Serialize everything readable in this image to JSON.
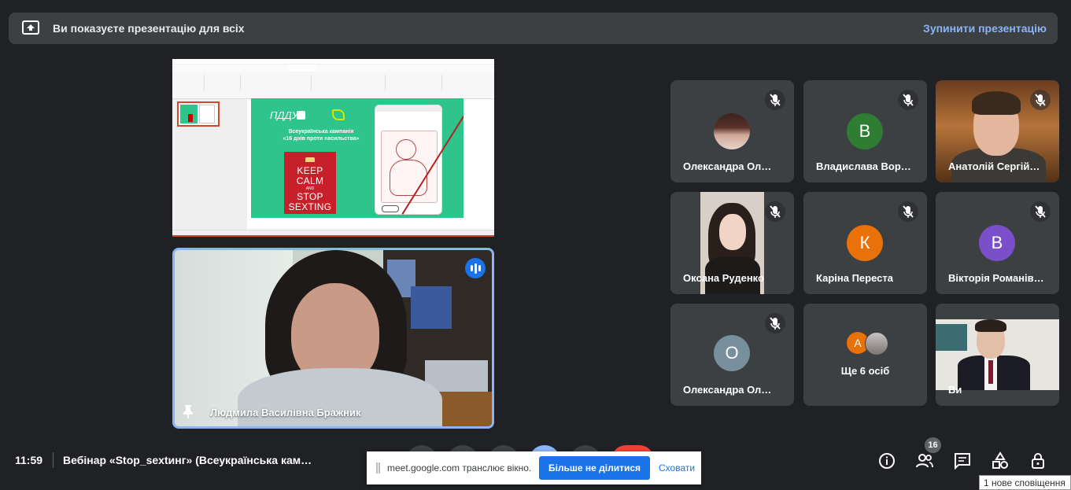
{
  "banner": {
    "title": "Ви показуєте презентацію для всіх",
    "stop": "Зупинити презентацію"
  },
  "slide": {
    "logo": "ПДДУ",
    "campaign_line1": "Всеукраїнська кампанія",
    "campaign_line2": "«16 днів проти насильства»",
    "keep": "KEEP",
    "calm": "CALM",
    "and": "AND",
    "stop": "STOP",
    "sexting": "SEXTING"
  },
  "speaker": {
    "name": "Людмила Василівна Бражник"
  },
  "participants": [
    {
      "name": "Олександра Ол…",
      "type": "photo-avatar"
    },
    {
      "name": "Владислава Вор…",
      "initial": "В",
      "color": "#2f7d32"
    },
    {
      "name": "Анатолій Сергій…",
      "type": "video"
    },
    {
      "name": "Оксана Руденко",
      "type": "video"
    },
    {
      "name": "Каріна Переста",
      "initial": "К",
      "color": "#e8710a"
    },
    {
      "name": "Вікторія Романів…",
      "initial": "В",
      "color": "#7b4fc9"
    },
    {
      "name": "Олександра Ол…",
      "initial": "О",
      "color": "#78909c"
    },
    {
      "name": "Ще 6 осіб",
      "initial": "А"
    },
    {
      "name": "Ви",
      "type": "video"
    }
  ],
  "bottom": {
    "time": "11:59",
    "meeting_title": "Вебінар «Stop_sextинг» (Всеукраїнська кам…",
    "people_count": "16"
  },
  "share_bar": {
    "text": "meet.google.com транслює вікно.",
    "stop_button": "Більше не ділитися",
    "hide": "Сховати"
  },
  "notification": "1 нове сповіщення",
  "colors": {
    "background": "#202124",
    "tile": "#3c4043",
    "accent": "#8ab4f8",
    "slide_green": "#2ec48c",
    "keep_red": "#c8202b"
  }
}
